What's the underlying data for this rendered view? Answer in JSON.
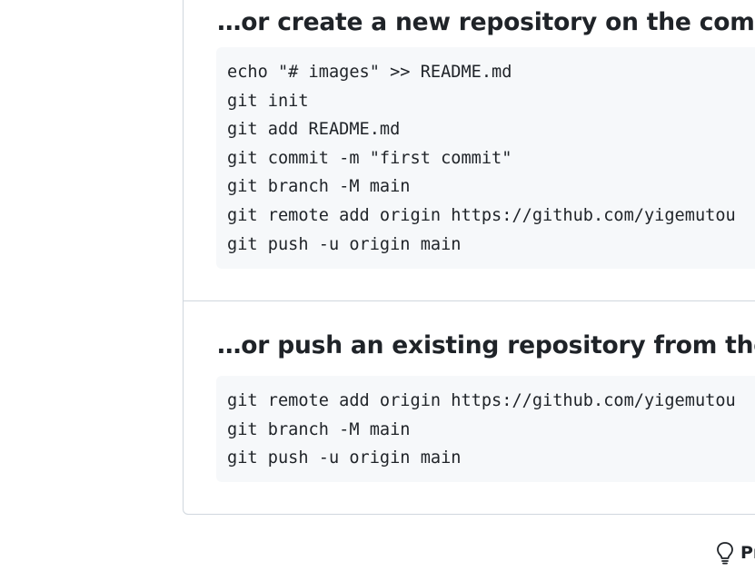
{
  "create_section": {
    "heading": "…or create a new repository on the command line",
    "commands": [
      "echo \"# images\" >> README.md",
      "git init",
      "git add README.md",
      "git commit -m \"first commit\"",
      "git branch -M main",
      "git remote add origin https://github.com/yigemutou",
      "git push -u origin main"
    ]
  },
  "push_section": {
    "heading": "…or push an existing repository from the command line",
    "commands": [
      "git remote add origin https://github.com/yigemutou",
      "git branch -M main",
      "git push -u origin main"
    ]
  },
  "footer": {
    "tip_icon": "light-bulb-icon",
    "tip_label": "ProTip!"
  },
  "colors": {
    "text": "#1f2328",
    "code_background": "#f6f8fa",
    "border": "#d0d7de"
  }
}
